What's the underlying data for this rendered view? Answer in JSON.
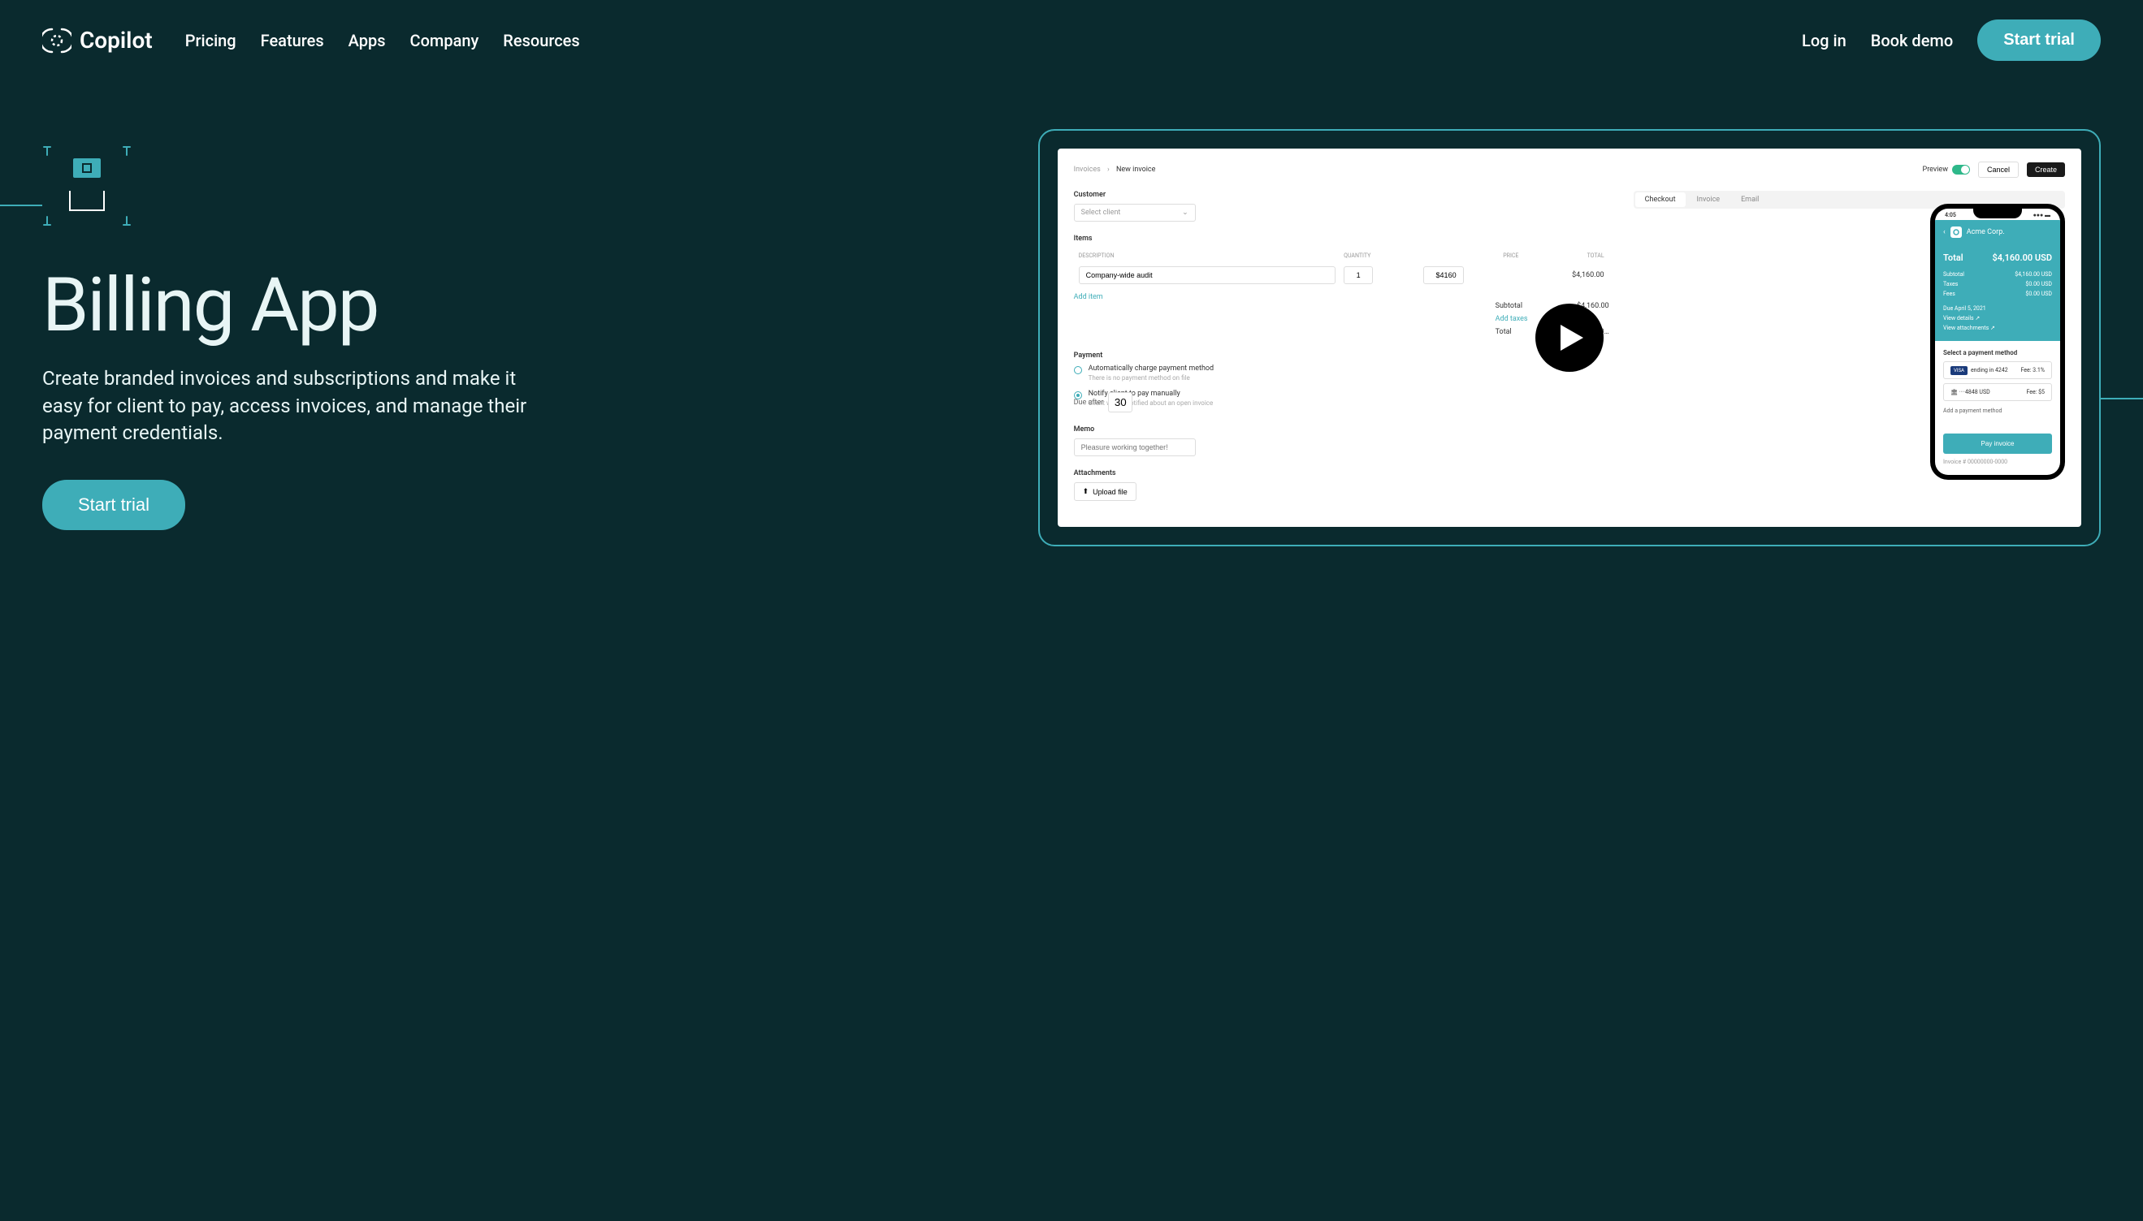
{
  "header": {
    "brand": "Copilot",
    "nav": [
      "Pricing",
      "Features",
      "Apps",
      "Company",
      "Resources"
    ],
    "login": "Log in",
    "book_demo": "Book demo",
    "start_trial": "Start trial"
  },
  "hero": {
    "title": "Billing App",
    "subtitle": "Create branded invoices and subscriptions and make it easy for client to pay, access invoices, and manage their payment credentials.",
    "cta": "Start trial"
  },
  "invoice": {
    "breadcrumb": {
      "root": "Invoices",
      "current": "New invoice"
    },
    "preview_label": "Preview",
    "cancel": "Cancel",
    "create": "Create",
    "customer_label": "Customer",
    "customer_placeholder": "Select client",
    "items_label": "Items",
    "columns": {
      "desc": "DESCRIPTION",
      "qty": "QUANTITY",
      "price": "PRICE",
      "total": "TOTAL"
    },
    "item": {
      "desc": "Company-wide audit",
      "qty": "1",
      "price": "$4160",
      "total": "$4,160.00"
    },
    "add_item": "Add item",
    "subtotal_label": "Subtotal",
    "subtotal": "$4,160.00",
    "add_taxes": "Add taxes",
    "total_label": "Total",
    "total": "$4,160…",
    "payment_label": "Payment",
    "payment_auto": {
      "title": "Automatically charge payment method",
      "sub": "There is no payment method on file"
    },
    "payment_manual": {
      "title": "Notify client to pay manually",
      "sub": "Client will be notified about an open invoice"
    },
    "due_after_label": "Due after",
    "due_after_value": "30",
    "memo_label": "Memo",
    "memo_placeholder": "Pleasure working together!",
    "attachments_label": "Attachments",
    "upload": "Upload file",
    "tabs": [
      "Checkout",
      "Invoice",
      "Email"
    ]
  },
  "phone": {
    "time": "4:05",
    "company": "Acme Corp.",
    "total_label": "Total",
    "total_value": "$4,160.00 USD",
    "rows": [
      {
        "label": "Subtotal",
        "value": "$4,160.00 USD"
      },
      {
        "label": "Taxes",
        "value": "$0.00 USD"
      },
      {
        "label": "Fees",
        "value": "$0.00 USD"
      }
    ],
    "due_date": "Due April 5, 2021",
    "view_details": "View details  ↗",
    "view_attachments": "View attachments  ↗",
    "select_payment": "Select a payment method",
    "card1": {
      "label": "ending in 4242",
      "fee": "Fee: 3.1%"
    },
    "card2": {
      "label": "····4848 USD",
      "fee": "Fee: $5"
    },
    "add_method": "Add a payment method",
    "pay_button": "Pay invoice",
    "invoice_number": "Invoice # 00000000-0000"
  }
}
